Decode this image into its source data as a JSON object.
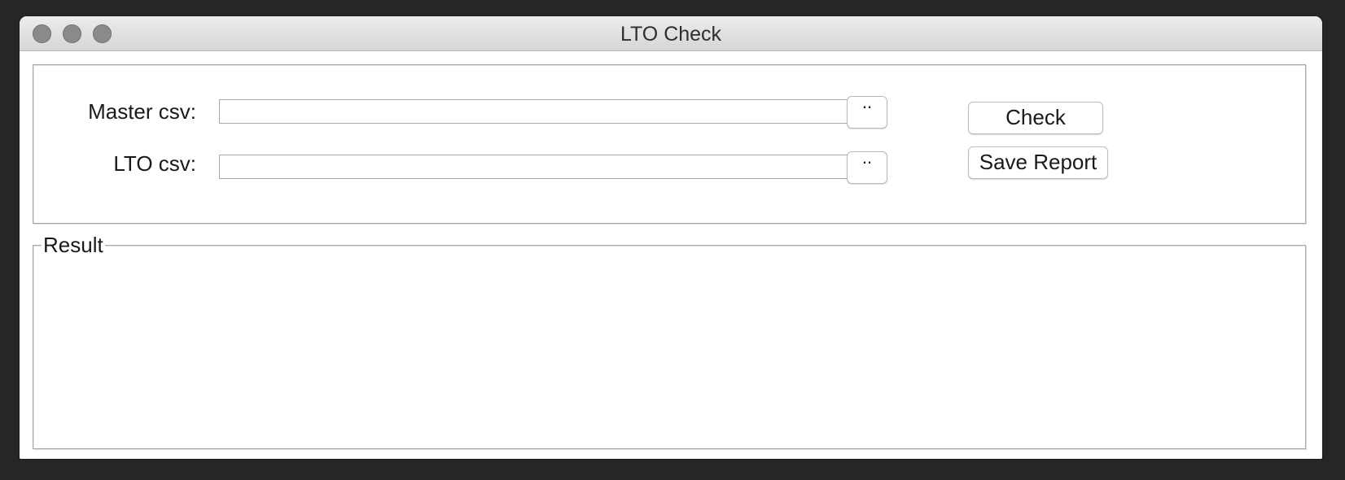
{
  "window": {
    "title": "LTO Check"
  },
  "form": {
    "master": {
      "label": "Master csv:",
      "value": "",
      "browse_label": ".."
    },
    "lto": {
      "label": "LTO csv:",
      "value": "",
      "browse_label": ".."
    }
  },
  "actions": {
    "check_label": "Check",
    "save_label": "Save Report"
  },
  "result": {
    "title": "Result",
    "text": ""
  },
  "icons": {
    "close": "traffic-light-close-icon",
    "minimize": "traffic-light-minimize-icon",
    "zoom": "traffic-light-zoom-icon"
  },
  "colors": {
    "traffic_light_inactive": "#8a8a8a",
    "window_background": "#ffffff",
    "desktop_background": "#262626"
  }
}
